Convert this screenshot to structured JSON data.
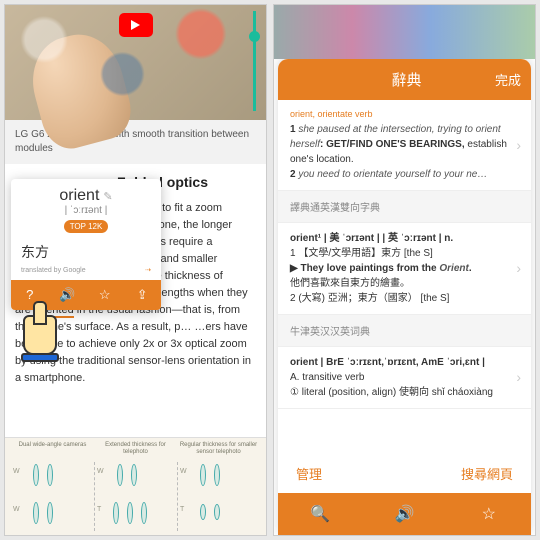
{
  "left": {
    "caption": "LG G6 zoom preview with smooth transition between modules",
    "heading_suffix": ": Folded optics",
    "article_p1a": "difficult to fit a zoom",
    "article_p1b": "of a phone, the longer",
    "article_p1c": "o lenses require a",
    "article_p1d": "design and smaller",
    "article_p1e": " that the thickness of",
    "article_p2": "the phone's limited lens focal lengths when they are oriented in the usual fashion—that is, from the phone's surface. As a result, p… …ers have been able to achieve only 2x or 3x optical zoom by using the traditional sensor-lens orientation in a smartphone.",
    "oriented": "oriented",
    "popup": {
      "word": "orient",
      "ipa": "| ˈɔːrɪənt |",
      "badge": "TOP 12K",
      "translation": "东方",
      "translated_by": "translated by Google"
    },
    "diagram": {
      "col1": "Dual wide-angle cameras",
      "col2": "Extended thickness for telephoto",
      "col3": "Regular thickness for smaller sensor telephoto",
      "W": "W",
      "T": "T"
    }
  },
  "right": {
    "header_title": "辭典",
    "header_done": "完成",
    "top_line": "orient, orientate verb",
    "sense1_pre": "1 ",
    "sense1_it": "she paused at the intersection, trying to orient herself",
    "sense1_b": ": GET/FIND ONE'S BEARINGS, ",
    "sense1_rest": "establish one's location.",
    "sense2_pre": "2 ",
    "sense2_it": "you need to orientate yourself to your ne…",
    "dict2_name": "譯典通英漢雙向字典",
    "d2_head": "orient¹ | 美 ˈɔrɪənt | | 英 ˈɔːrɪənt | n.",
    "d2_l1": "1 【文學/文學用語】東方 [the S]",
    "d2_l2": "▶ They love paintings from the Orient.",
    "d2_l3": "他們喜歡來自東方的繪畫。",
    "d2_l4": "2 (大寫) 亞洲；東方（國家） [the S]",
    "dict3_name": "牛津英汉汉英词典",
    "d3_head": "orient | BrE ˈɔːrɪɛnt,ˈɒrɪɛnt, AmE ˈɔri,ɛnt |",
    "d3_l1": "A. transitive verb",
    "d3_l2": "① literal (position, align) 使朝向 shǐ cháoxiàng",
    "footer_manage": "管理",
    "footer_search": "搜尋網頁"
  }
}
